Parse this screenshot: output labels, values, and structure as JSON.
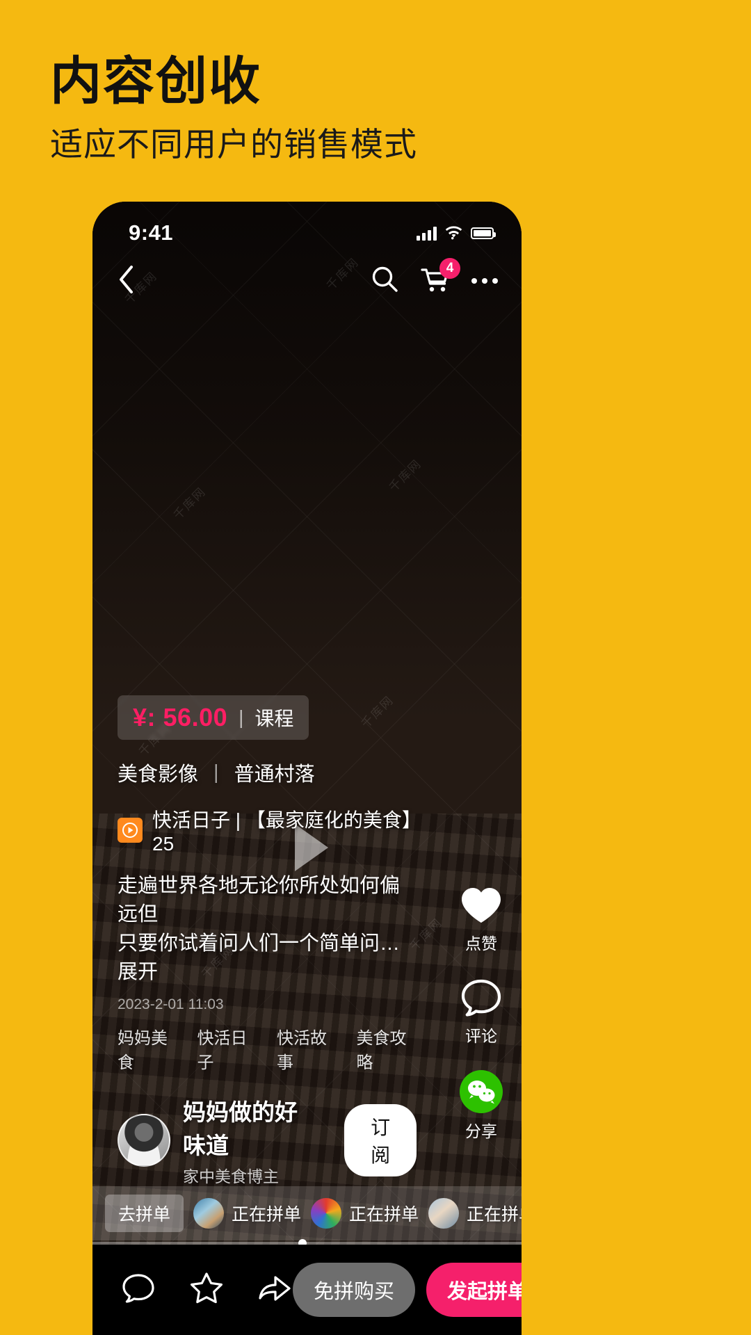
{
  "poster": {
    "title": "内容创收",
    "subtitle": "适应不同用户的销售模式",
    "background_color": "#F5B911",
    "watermark": "千库网"
  },
  "phone": {
    "status_bar": {
      "time": "9:41",
      "signal_icon": "signal-bars-icon",
      "wifi_icon": "wifi-icon",
      "battery_icon": "battery-icon"
    },
    "nav_bar": {
      "back_icon": "chevron-left-icon",
      "search_icon": "search-icon",
      "cart_icon": "shopping-cart-icon",
      "cart_badge": "4",
      "more_icon": "more-horizontal-icon"
    },
    "video": {
      "play_icon": "play-triangle-icon"
    },
    "overlay": {
      "price_symbol": "¥:",
      "price_value": "56.00",
      "price_divider": "|",
      "price_type": "课程",
      "price_color": "#FF1E64",
      "categories": [
        "美食影像",
        "普通村落"
      ],
      "category_divider": "|",
      "series_badge_icon": "play-circle-icon",
      "series_text": "快活日子 | 【最家庭化的美食】25",
      "description_line1": "走遍世界各地无论你所处如何偏远但",
      "description_line2": "只要你试着问人们一个简单问…展开",
      "timestamp": "2023-2-01 11:03",
      "tags": [
        "妈妈美食",
        "快活日子",
        "快活故事",
        "美食攻略"
      ],
      "author_name": "妈妈做的好味道",
      "author_role": "家中美食博主",
      "subscribe_label": "订阅"
    },
    "rail": [
      {
        "icon": "heart-icon",
        "label": "点赞"
      },
      {
        "icon": "comment-icon",
        "label": "评论"
      },
      {
        "icon": "wechat-icon",
        "label": "分享"
      }
    ],
    "group_buy": {
      "cta_label": "去拼单",
      "items": [
        {
          "avatar": "user-avatar-1",
          "label": "正在拼单"
        },
        {
          "avatar": "user-avatar-2",
          "label": "正在拼单"
        },
        {
          "avatar": "user-avatar-3",
          "label": "正在拼单"
        }
      ],
      "arrow_icon": "chevron-right-icon"
    },
    "bottom_bar": {
      "comment_icon": "speech-bubble-icon",
      "favorite_icon": "star-icon",
      "share_icon": "share-arrow-icon",
      "free_buy_label": "免拼购买",
      "start_group_label": "发起拼单",
      "start_group_color": "#F5206B"
    }
  }
}
